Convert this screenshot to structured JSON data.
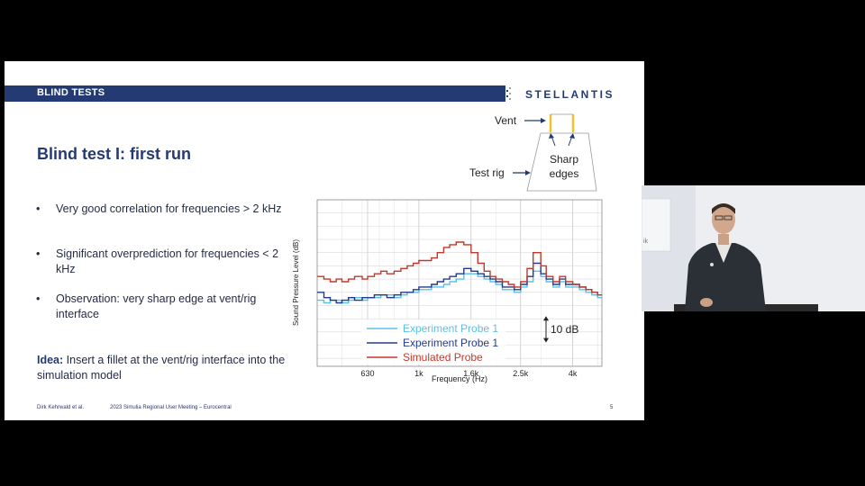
{
  "slide": {
    "header_title": "BLIND TESTS",
    "logo_text": "STELLANTIS",
    "title": "Blind test I: first run",
    "bullets": [
      "Very good correlation for frequencies > 2 kHz",
      "Significant  overprediction for frequencies < 2 kHz",
      "Observation: very sharp edge at vent/rig interface"
    ],
    "idea_label": "Idea:",
    "idea_text": " Insert a fillet at the vent/rig interface into the simulation model",
    "footer_author": "Dirk Kehrwald et al.",
    "footer_event": "2023 Simulia Regional User Meeting – Eurocentral",
    "page_number": "5"
  },
  "diagram": {
    "vent_label": "Vent",
    "rig_label": "Test rig",
    "edges_label_1": "Sharp",
    "edges_label_2": "edges"
  },
  "chart_data": {
    "type": "line",
    "xlabel": "Frequency (Hz)",
    "ylabel": "Sound Pressure Level (dB)",
    "x_scale": "log",
    "xlim": [
      400,
      5200
    ],
    "ylim": [
      -8,
      55
    ],
    "x_ticks": [
      630,
      1000,
      1600,
      2500,
      4000
    ],
    "x_tick_labels": [
      "630",
      "1k",
      "1.6k",
      "2.5k",
      "4k"
    ],
    "scale_bar_label": "10 dB",
    "scale_bar_db": 10,
    "grid": true,
    "legend_position": "bottom-center",
    "x": [
      400,
      425,
      450,
      475,
      500,
      530,
      560,
      600,
      630,
      670,
      710,
      750,
      800,
      850,
      900,
      950,
      1000,
      1060,
      1120,
      1180,
      1250,
      1320,
      1400,
      1500,
      1600,
      1700,
      1800,
      1900,
      2000,
      2120,
      2240,
      2360,
      2500,
      2650,
      2800,
      3000,
      3150,
      3350,
      3550,
      3750,
      4000,
      4250,
      4500,
      4750,
      5000
    ],
    "series": [
      {
        "name": "Experiment Probe 1",
        "color": "#5bc0e8",
        "values": [
          17,
          16,
          17,
          17,
          16,
          17,
          18,
          17,
          18,
          18,
          19,
          19,
          18,
          19,
          20,
          20,
          21,
          21,
          22,
          22,
          23,
          24,
          25,
          27,
          27,
          26,
          25,
          24,
          23,
          21,
          21,
          20,
          22,
          24,
          28,
          26,
          24,
          22,
          24,
          22,
          22,
          21,
          20,
          19,
          18
        ]
      },
      {
        "name": "Experiment Probe 1",
        "color": "#243a8c",
        "values": [
          20,
          18,
          17,
          16,
          17,
          18,
          17,
          18,
          18,
          19,
          19,
          18,
          19,
          20,
          20,
          21,
          22,
          22,
          23,
          24,
          25,
          26,
          27,
          29,
          28,
          27,
          26,
          25,
          24,
          22,
          22,
          21,
          23,
          26,
          31,
          27,
          25,
          23,
          25,
          23,
          23,
          22,
          21,
          20,
          19
        ]
      },
      {
        "name": "Simulated Probe",
        "color": "#c0392b",
        "values": [
          26,
          25,
          24,
          25,
          24,
          25,
          26,
          25,
          26,
          27,
          28,
          27,
          28,
          29,
          30,
          31,
          32,
          32,
          33,
          35,
          37,
          38,
          39,
          38,
          35,
          31,
          28,
          26,
          25,
          24,
          23,
          22,
          24,
          29,
          35,
          30,
          26,
          24,
          26,
          24,
          23,
          22,
          21,
          20,
          19
        ]
      }
    ]
  },
  "presenter_video": {
    "wall_text": "ik"
  }
}
